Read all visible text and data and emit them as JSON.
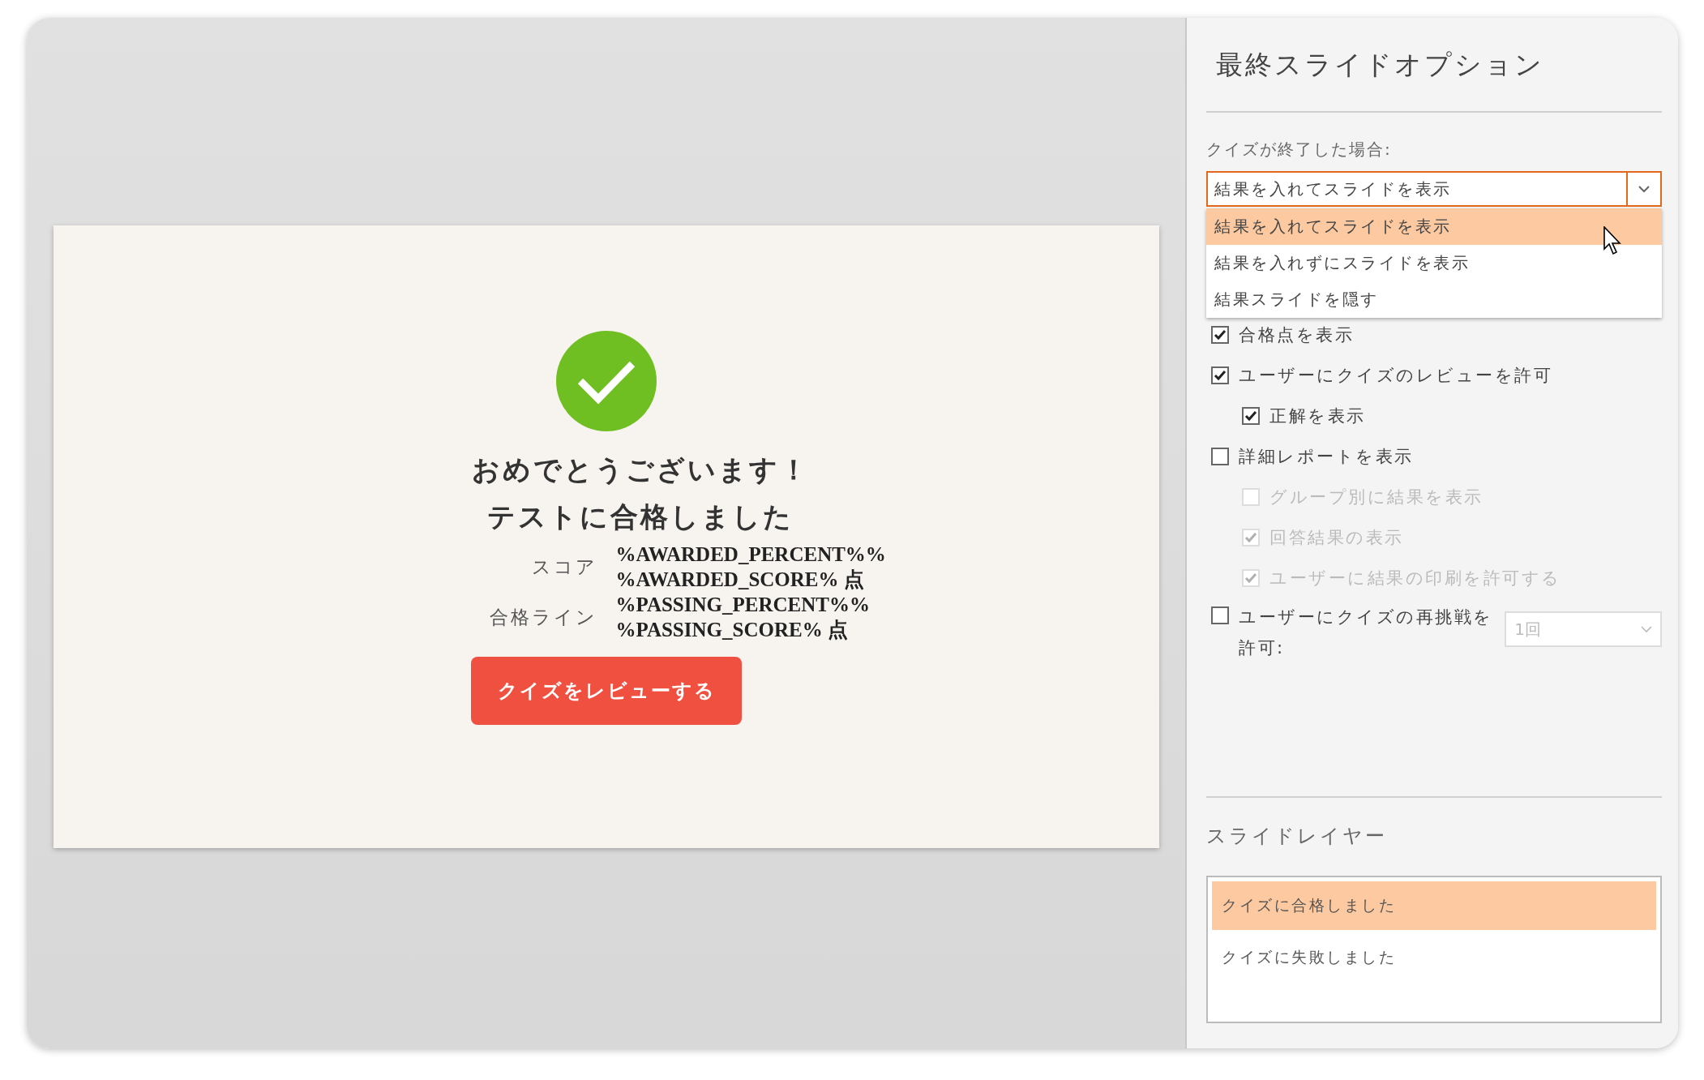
{
  "slide": {
    "title_lines": [
      "おめでとうございます！",
      "テストに合格しました"
    ],
    "score_rows": [
      {
        "label": "スコア",
        "values": [
          "%AWARDED_PERCENT%%",
          "%AWARDED_SCORE% 点"
        ]
      },
      {
        "label": "合格ライン",
        "values": [
          "%PASSING_PERCENT%%",
          "%PASSING_SCORE% 点"
        ]
      }
    ],
    "review_button": "クイズをレビューする"
  },
  "panel": {
    "title": "最終スライドオプション",
    "on_finish": {
      "label": "クイズが終了した場合:",
      "value": "結果を入れてスライドを表示",
      "expanded": true,
      "options": [
        {
          "label": "結果を入れてスライドを表示",
          "selected": true
        },
        {
          "label": "結果を入れずにスライドを表示",
          "selected": false
        },
        {
          "label": "結果スライドを隠す",
          "selected": false
        }
      ]
    },
    "options": [
      {
        "label": "合格点を表示",
        "checked": true,
        "disabled": false
      },
      {
        "label": "ユーザーにクイズのレビューを許可",
        "checked": true,
        "disabled": false,
        "children": [
          {
            "label": "正解を表示",
            "checked": true,
            "disabled": false
          }
        ]
      },
      {
        "label": "詳細レポートを表示",
        "checked": false,
        "disabled": false,
        "children": [
          {
            "label": "グループ別に結果を表示",
            "checked": false,
            "disabled": true
          },
          {
            "label": "回答結果の表示",
            "checked": true,
            "disabled": true
          },
          {
            "label": "ユーザーに結果の印刷を許可する",
            "checked": true,
            "disabled": true
          }
        ]
      }
    ],
    "retry": {
      "label": "ユーザーにクイズの再挑戦を許可:",
      "checked": false,
      "attempts": {
        "value": "1回",
        "disabled": true
      }
    },
    "layers": {
      "heading": "スライドレイヤー",
      "items": [
        {
          "label": "クイズに合格しました",
          "selected": true
        },
        {
          "label": "クイズに失敗しました",
          "selected": false
        }
      ]
    }
  }
}
